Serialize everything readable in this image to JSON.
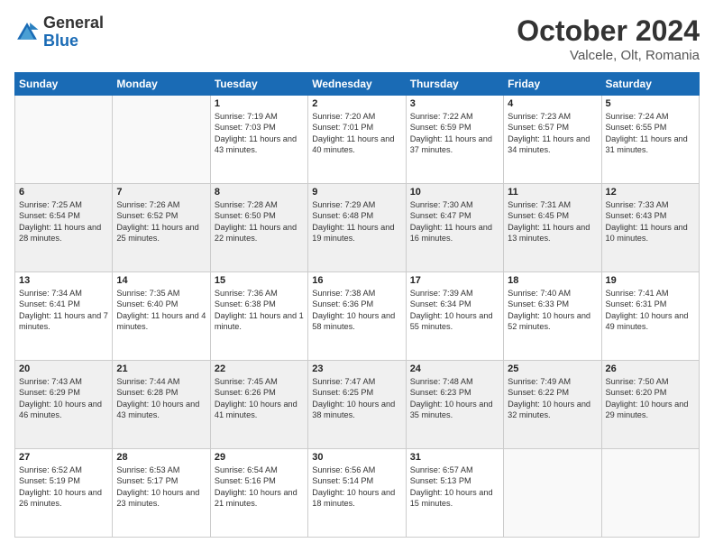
{
  "header": {
    "logo": {
      "general": "General",
      "blue": "Blue"
    },
    "title": "October 2024",
    "location": "Valcele, Olt, Romania"
  },
  "weekdays": [
    "Sunday",
    "Monday",
    "Tuesday",
    "Wednesday",
    "Thursday",
    "Friday",
    "Saturday"
  ],
  "weeks": [
    [
      {
        "num": "",
        "sunrise": "",
        "sunset": "",
        "daylight": "",
        "empty": true
      },
      {
        "num": "",
        "sunrise": "",
        "sunset": "",
        "daylight": "",
        "empty": true
      },
      {
        "num": "1",
        "sunrise": "Sunrise: 7:19 AM",
        "sunset": "Sunset: 7:03 PM",
        "daylight": "Daylight: 11 hours and 43 minutes."
      },
      {
        "num": "2",
        "sunrise": "Sunrise: 7:20 AM",
        "sunset": "Sunset: 7:01 PM",
        "daylight": "Daylight: 11 hours and 40 minutes."
      },
      {
        "num": "3",
        "sunrise": "Sunrise: 7:22 AM",
        "sunset": "Sunset: 6:59 PM",
        "daylight": "Daylight: 11 hours and 37 minutes."
      },
      {
        "num": "4",
        "sunrise": "Sunrise: 7:23 AM",
        "sunset": "Sunset: 6:57 PM",
        "daylight": "Daylight: 11 hours and 34 minutes."
      },
      {
        "num": "5",
        "sunrise": "Sunrise: 7:24 AM",
        "sunset": "Sunset: 6:55 PM",
        "daylight": "Daylight: 11 hours and 31 minutes."
      }
    ],
    [
      {
        "num": "6",
        "sunrise": "Sunrise: 7:25 AM",
        "sunset": "Sunset: 6:54 PM",
        "daylight": "Daylight: 11 hours and 28 minutes."
      },
      {
        "num": "7",
        "sunrise": "Sunrise: 7:26 AM",
        "sunset": "Sunset: 6:52 PM",
        "daylight": "Daylight: 11 hours and 25 minutes."
      },
      {
        "num": "8",
        "sunrise": "Sunrise: 7:28 AM",
        "sunset": "Sunset: 6:50 PM",
        "daylight": "Daylight: 11 hours and 22 minutes."
      },
      {
        "num": "9",
        "sunrise": "Sunrise: 7:29 AM",
        "sunset": "Sunset: 6:48 PM",
        "daylight": "Daylight: 11 hours and 19 minutes."
      },
      {
        "num": "10",
        "sunrise": "Sunrise: 7:30 AM",
        "sunset": "Sunset: 6:47 PM",
        "daylight": "Daylight: 11 hours and 16 minutes."
      },
      {
        "num": "11",
        "sunrise": "Sunrise: 7:31 AM",
        "sunset": "Sunset: 6:45 PM",
        "daylight": "Daylight: 11 hours and 13 minutes."
      },
      {
        "num": "12",
        "sunrise": "Sunrise: 7:33 AM",
        "sunset": "Sunset: 6:43 PM",
        "daylight": "Daylight: 11 hours and 10 minutes."
      }
    ],
    [
      {
        "num": "13",
        "sunrise": "Sunrise: 7:34 AM",
        "sunset": "Sunset: 6:41 PM",
        "daylight": "Daylight: 11 hours and 7 minutes."
      },
      {
        "num": "14",
        "sunrise": "Sunrise: 7:35 AM",
        "sunset": "Sunset: 6:40 PM",
        "daylight": "Daylight: 11 hours and 4 minutes."
      },
      {
        "num": "15",
        "sunrise": "Sunrise: 7:36 AM",
        "sunset": "Sunset: 6:38 PM",
        "daylight": "Daylight: 11 hours and 1 minute."
      },
      {
        "num": "16",
        "sunrise": "Sunrise: 7:38 AM",
        "sunset": "Sunset: 6:36 PM",
        "daylight": "Daylight: 10 hours and 58 minutes."
      },
      {
        "num": "17",
        "sunrise": "Sunrise: 7:39 AM",
        "sunset": "Sunset: 6:34 PM",
        "daylight": "Daylight: 10 hours and 55 minutes."
      },
      {
        "num": "18",
        "sunrise": "Sunrise: 7:40 AM",
        "sunset": "Sunset: 6:33 PM",
        "daylight": "Daylight: 10 hours and 52 minutes."
      },
      {
        "num": "19",
        "sunrise": "Sunrise: 7:41 AM",
        "sunset": "Sunset: 6:31 PM",
        "daylight": "Daylight: 10 hours and 49 minutes."
      }
    ],
    [
      {
        "num": "20",
        "sunrise": "Sunrise: 7:43 AM",
        "sunset": "Sunset: 6:29 PM",
        "daylight": "Daylight: 10 hours and 46 minutes."
      },
      {
        "num": "21",
        "sunrise": "Sunrise: 7:44 AM",
        "sunset": "Sunset: 6:28 PM",
        "daylight": "Daylight: 10 hours and 43 minutes."
      },
      {
        "num": "22",
        "sunrise": "Sunrise: 7:45 AM",
        "sunset": "Sunset: 6:26 PM",
        "daylight": "Daylight: 10 hours and 41 minutes."
      },
      {
        "num": "23",
        "sunrise": "Sunrise: 7:47 AM",
        "sunset": "Sunset: 6:25 PM",
        "daylight": "Daylight: 10 hours and 38 minutes."
      },
      {
        "num": "24",
        "sunrise": "Sunrise: 7:48 AM",
        "sunset": "Sunset: 6:23 PM",
        "daylight": "Daylight: 10 hours and 35 minutes."
      },
      {
        "num": "25",
        "sunrise": "Sunrise: 7:49 AM",
        "sunset": "Sunset: 6:22 PM",
        "daylight": "Daylight: 10 hours and 32 minutes."
      },
      {
        "num": "26",
        "sunrise": "Sunrise: 7:50 AM",
        "sunset": "Sunset: 6:20 PM",
        "daylight": "Daylight: 10 hours and 29 minutes."
      }
    ],
    [
      {
        "num": "27",
        "sunrise": "Sunrise: 6:52 AM",
        "sunset": "Sunset: 5:19 PM",
        "daylight": "Daylight: 10 hours and 26 minutes."
      },
      {
        "num": "28",
        "sunrise": "Sunrise: 6:53 AM",
        "sunset": "Sunset: 5:17 PM",
        "daylight": "Daylight: 10 hours and 23 minutes."
      },
      {
        "num": "29",
        "sunrise": "Sunrise: 6:54 AM",
        "sunset": "Sunset: 5:16 PM",
        "daylight": "Daylight: 10 hours and 21 minutes."
      },
      {
        "num": "30",
        "sunrise": "Sunrise: 6:56 AM",
        "sunset": "Sunset: 5:14 PM",
        "daylight": "Daylight: 10 hours and 18 minutes."
      },
      {
        "num": "31",
        "sunrise": "Sunrise: 6:57 AM",
        "sunset": "Sunset: 5:13 PM",
        "daylight": "Daylight: 10 hours and 15 minutes."
      },
      {
        "num": "",
        "sunrise": "",
        "sunset": "",
        "daylight": "",
        "empty": true
      },
      {
        "num": "",
        "sunrise": "",
        "sunset": "",
        "daylight": "",
        "empty": true
      }
    ]
  ]
}
